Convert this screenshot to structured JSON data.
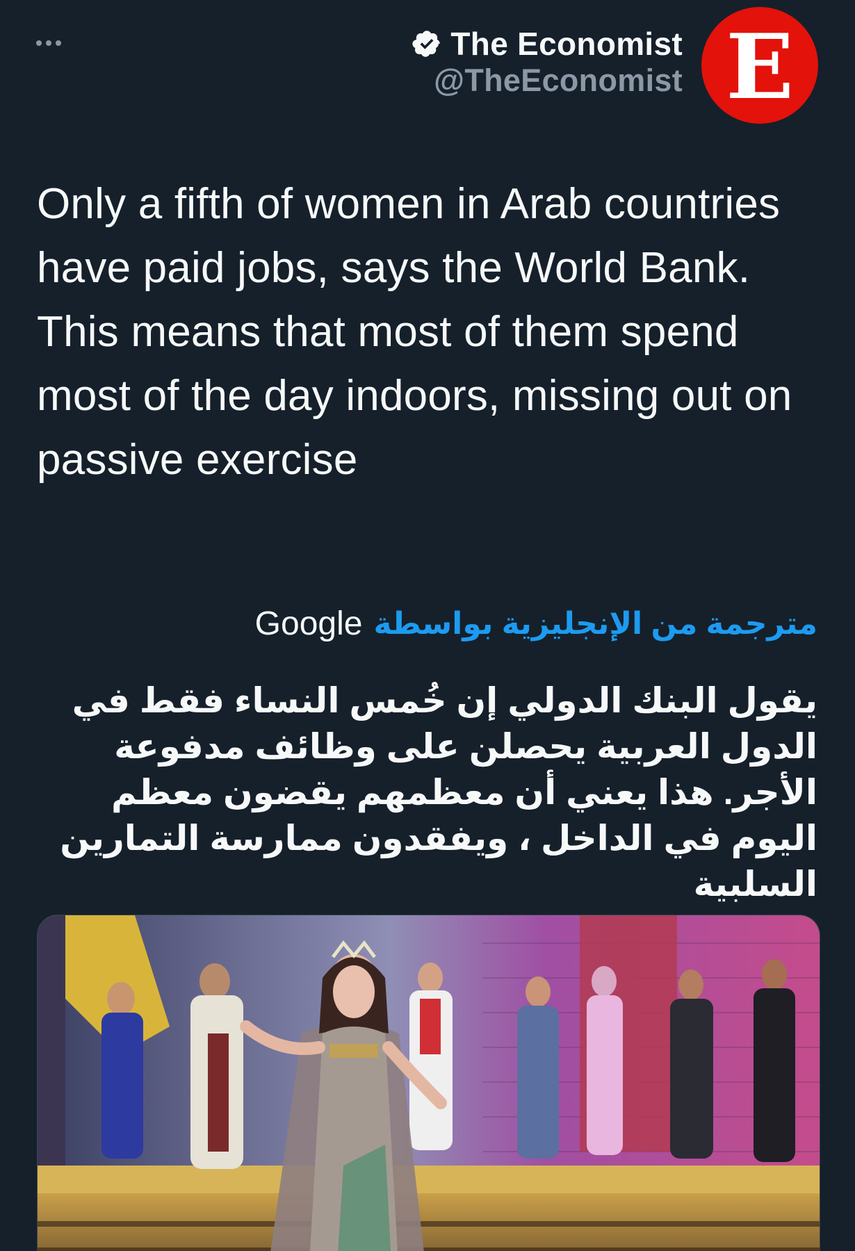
{
  "header": {
    "more_icon": "more-horizontal-icon",
    "display_name": "The Economist",
    "handle": "@TheEconomist",
    "verified_icon": "verified-badge-icon",
    "avatar_letter": "E",
    "avatar_color": "#e3120b"
  },
  "tweet": {
    "text": "Only a fifth of women in Arab countries have paid jobs, says the World Bank. This means that most of them spend most of the day indoors, missing out on passive exercise"
  },
  "translation": {
    "link_label": "مترجمة من الإنجليزية بواسطة",
    "provider": "Google",
    "text": "يقول البنك الدولي إن خُمس النساء فقط في الدول العربية يحصلن على وظائف مدفوعة الأجر. هذا يعني أن معظمهم يقضون معظم اليوم في الداخل ، ويفقدون ممارسة التمارين السلبية"
  },
  "colors": {
    "background": "#15202b",
    "text_primary": "#f7f9f9",
    "text_secondary": "#8b98a5",
    "link": "#1d9bf0"
  },
  "media": {
    "type": "photo"
  }
}
